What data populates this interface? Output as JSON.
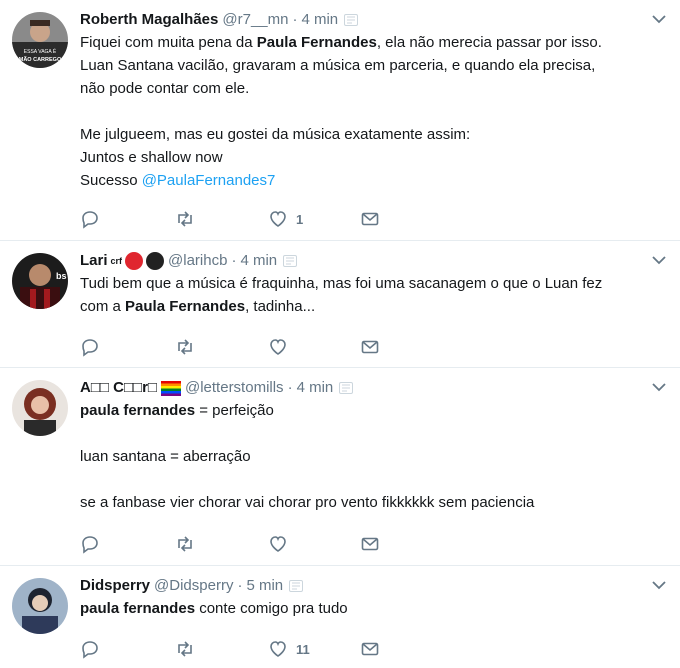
{
  "tweets": [
    {
      "name": "Roberth Magalhães",
      "handle": "@r7__mn",
      "sep": "·",
      "time": "4 min",
      "body": {
        "l1a": "Fiquei com muita pena da ",
        "l1b": "Paula Fernandes",
        "l1c": ", ela não merecia passar por isso.",
        "l2": "Luan Santana vacilão, gravaram a música em parceria, e quando ela precisa,",
        "l3": "não pode contar com ele.",
        "l4": "Me julgueem, mas eu gostei da música exatamente assim:",
        "l5": "Juntos e shallow now",
        "l6a": "Sucesso ",
        "l6b": "@PaulaFernandes7"
      },
      "like_count": "1",
      "avatar_text_1": "ESSA VAGA É",
      "avatar_text_2": "MÃO CARREGO"
    },
    {
      "name": "Lari",
      "name_suffix": "crf",
      "handle": "@larihcb",
      "sep": "·",
      "time": "4 min",
      "body": {
        "l1": "Tudi bem que a música é fraquinha, mas foi uma sacanagem o que o Luan fez",
        "l2a": "com a ",
        "l2b": "Paula Fernandes",
        "l2c": ", tadinha..."
      },
      "like_count": "",
      "avatar_text": "bs"
    },
    {
      "name": "A□□ C□□r□",
      "handle": "@letterstomills",
      "sep": "·",
      "time": "4 min",
      "body": {
        "l1a": "paula fernandes",
        "l1b": " = perfeição",
        "l2": "luan santana = aberração",
        "l3": "se a fanbase vier chorar vai chorar pro vento fikkkkkk sem paciencia"
      },
      "like_count": ""
    },
    {
      "name": "Didsperry",
      "handle": "@Didsperry",
      "sep": "·",
      "time": "5 min",
      "body": {
        "l1a": "paula fernandes",
        "l1b": " conte comigo pra tudo"
      },
      "like_count": "11"
    }
  ],
  "icons": {
    "reply": "reply-icon",
    "retweet": "retweet-icon",
    "like": "heart-icon",
    "dm": "envelope-icon",
    "caret": "chevron-down-icon"
  },
  "colors": {
    "text": "#14171a",
    "muted": "#657786",
    "link": "#1da1f2",
    "divider": "#e6ecf0"
  }
}
